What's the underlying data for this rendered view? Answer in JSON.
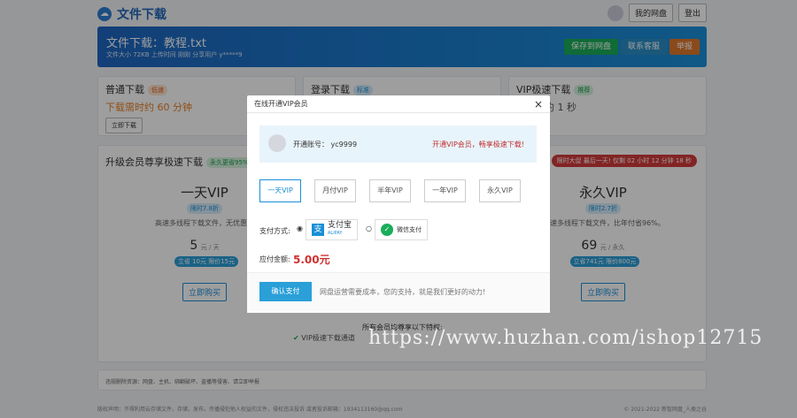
{
  "header": {
    "app_title": "文件下载",
    "my_disk": "我的网盘",
    "logout": "登出"
  },
  "banner": {
    "title": "文件下载：教程.txt",
    "meta": "文件大小 72KB   上传时间 刚刚   分享用户 y*****9",
    "save": "保存到网盘",
    "contact": "联系客服",
    "report": "举报",
    "colors": {
      "save": "#1aad5a",
      "contact": "#2a8fc7",
      "report": "#e0782a"
    }
  },
  "download_options": [
    {
      "title": "普通下载",
      "tag": "低速",
      "desc": "下载需时约 60 分钟",
      "button": "立即下载"
    },
    {
      "title": "登录下载",
      "tag": "标准",
      "desc": "",
      "button": ""
    },
    {
      "title": "VIP极速下载",
      "tag": "推荐",
      "desc": "约 1 秒",
      "button": ""
    }
  ],
  "upgrade": {
    "title": "升级会员尊享极速下载",
    "tag": "永久更省95%",
    "countdown": "限时大促 最后一天! 仅剩 02 小时 12 分钟 18 秒",
    "plans": [
      {
        "name": "一天VIP",
        "badge": "限时7.8折",
        "desc": "高速多线程下载文件，无优惠，",
        "price": "5",
        "unit": "元 / 天",
        "discount": "立省 10元 限价15元",
        "button": "立即购买"
      },
      {
        "name": "永久VIP",
        "badge": "限时2.7折",
        "desc": "速多线程下载文件，比年付省96%。",
        "price": "69",
        "unit": "元 / 永久",
        "discount": "立省741元 限价800元",
        "button": "立即购买"
      }
    ],
    "benefits_title": "所有会员均尊享以下特权:",
    "benefit_1": "VIP极速下载通道"
  },
  "notice": "违规删除资源：网盘、主机、绑翻破坏、盗播等侵害、请立即举报",
  "footer_left": "版权声明：不得利用云存储文件，存储，发布，传播侵犯他人权益的文件，侵权违法投诉 或者投诉邮箱：1934113160@qq.com",
  "footer_right": "© 2021-2022 新智网盘_人类之谷",
  "modal": {
    "title": "在线开通VIP会员",
    "close": "×",
    "account_label": "开通账号： yc9999",
    "account_promo": "开通VIP会员，畅享极速下载!",
    "plans": [
      "一天VIP",
      "月付VIP",
      "半年VIP",
      "一年VIP",
      "永久VIP"
    ],
    "pay_label": "支付方式:",
    "alipay": "支付宝",
    "alipay_sub": "ALIPAY",
    "wechat": "微信支付",
    "amount_label": "应付金额:",
    "amount": "5.00元",
    "confirm": "确认支付",
    "note": "网盘运营需要成本，您的支持，就是我们更好的动力!"
  },
  "watermark": "https://www.huzhan.com/ishop12715"
}
